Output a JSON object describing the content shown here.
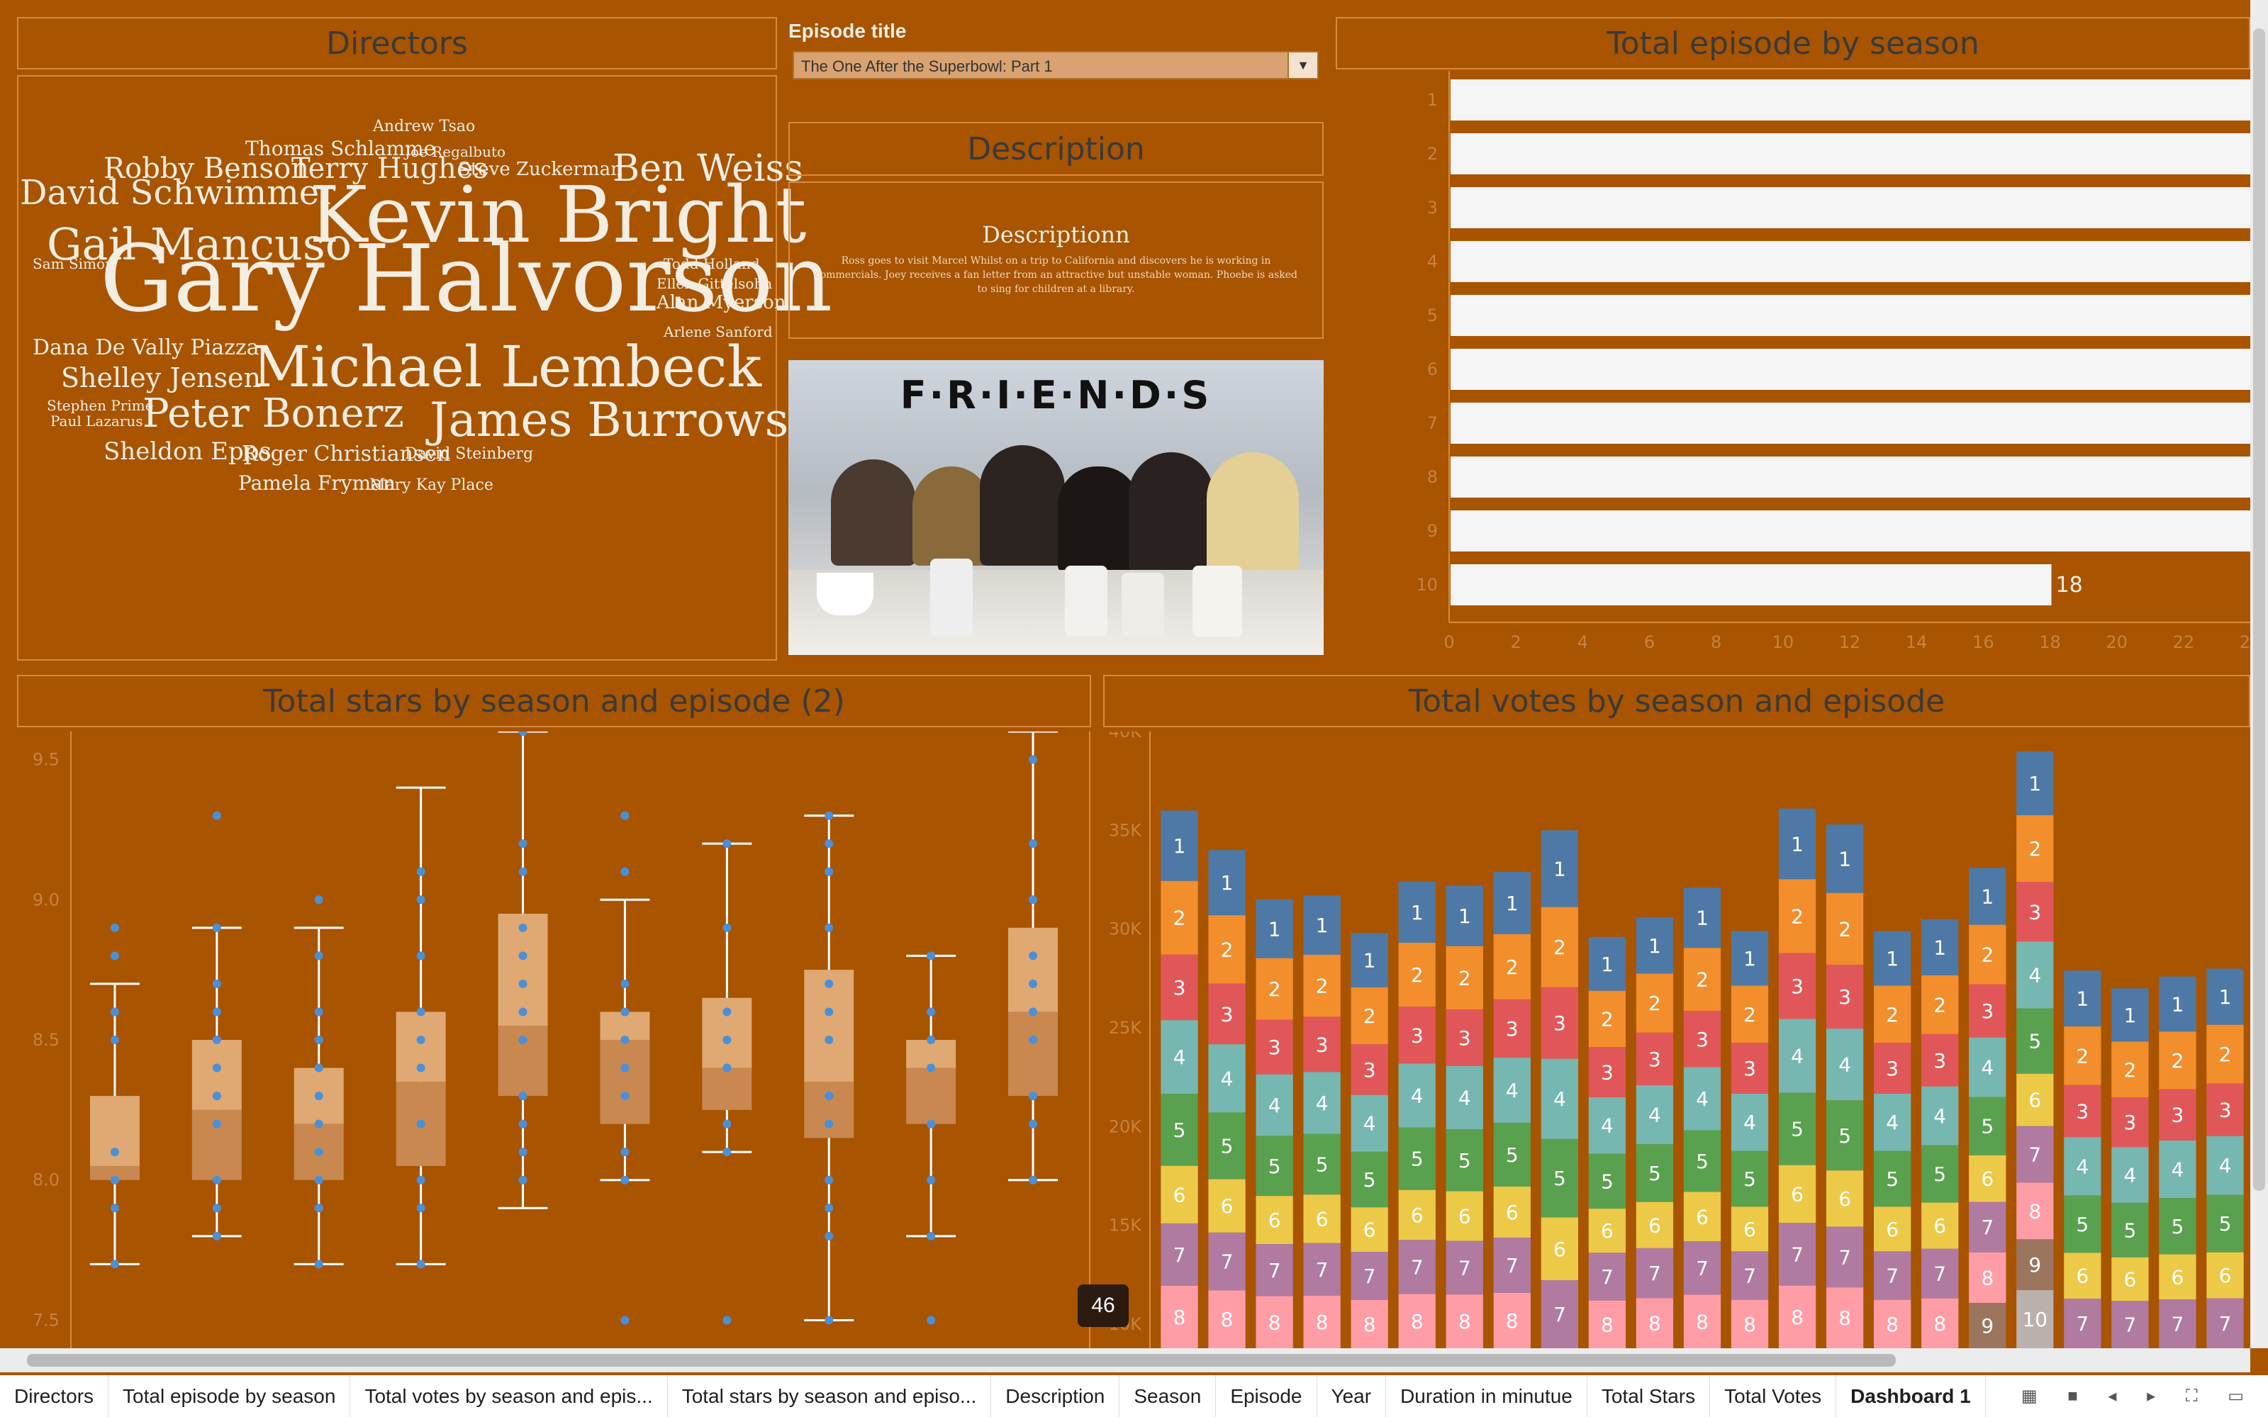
{
  "directors": {
    "title": "Directors",
    "words": [
      {
        "name": "Andrew Tsao",
        "size": 22
      },
      {
        "name": "Thomas Schlamme",
        "size": 28
      },
      {
        "name": "Joe Regalbuto",
        "size": 20
      },
      {
        "name": "Robby Benson",
        "size": 40
      },
      {
        "name": "Terry Hughes",
        "size": 40
      },
      {
        "name": "Steve Zuckerman",
        "size": 26
      },
      {
        "name": "Ben Weiss",
        "size": 52
      },
      {
        "name": "David Schwimmer",
        "size": 48
      },
      {
        "name": "Kevin Bright",
        "size": 110
      },
      {
        "name": "Gail Mancuso",
        "size": 62
      },
      {
        "name": "Sam Simon",
        "size": 20
      },
      {
        "name": "Gary Halvorson",
        "size": 130
      },
      {
        "name": "Todd Holland",
        "size": 20
      },
      {
        "name": "Ellen Gittelsohn",
        "size": 20
      },
      {
        "name": "Alan Myerson",
        "size": 26
      },
      {
        "name": "Arlene Sanford",
        "size": 20
      },
      {
        "name": "Dana De Vally Piazza",
        "size": 30
      },
      {
        "name": "Michael Lembeck",
        "size": 80
      },
      {
        "name": "Shelley Jensen",
        "size": 38
      },
      {
        "name": "Stephen Prime",
        "size": 20
      },
      {
        "name": "Peter Bonerz",
        "size": 56
      },
      {
        "name": "James Burrows",
        "size": 66
      },
      {
        "name": "Paul Lazarus",
        "size": 20
      },
      {
        "name": "Sheldon Epps",
        "size": 34
      },
      {
        "name": "Roger Christiansen",
        "size": 30
      },
      {
        "name": "David Steinberg",
        "size": 22
      },
      {
        "name": "Pamela Fryman",
        "size": 28
      },
      {
        "name": "Mary Kay Place",
        "size": 22
      }
    ]
  },
  "episode_filter": {
    "label": "Episode title",
    "value": "The One After the Superbowl: Part 1"
  },
  "description": {
    "title": "Description",
    "heading": "Descriptionn",
    "text": "Ross goes to visit Marcel Whilst on a trip to California and discovers he is working in commercials. Joey receives a fan letter from an attractive but unstable woman. Phoebe is asked to sing for children at a library."
  },
  "friends_image": {
    "logo": "F·R·I·E·N·D·S"
  },
  "colors": {
    "background": "#A85400",
    "bar": "#f5f5f5",
    "box": "#f0c08a",
    "point": "#4a90d9"
  },
  "tooltip_badge": "46",
  "tabs": [
    "Directors",
    "Total episode by season",
    "Total votes by season and epis...",
    "Total stars by season and episo...",
    "Description",
    "Season",
    "Episode",
    "Year",
    "Duration in minutue",
    "Total Stars",
    "Total Votes",
    "Dashboard 1"
  ],
  "chart_data": [
    {
      "type": "bar",
      "title": "Total episode by season",
      "categories": [
        "1",
        "2",
        "3",
        "4",
        "5",
        "6",
        "7",
        "8",
        "9",
        "10"
      ],
      "values": [
        24,
        24,
        25,
        24,
        24,
        25,
        24,
        24,
        24,
        18
      ],
      "data_labels": [
        "",
        "",
        "",
        "",
        "",
        "",
        "",
        "",
        "",
        "18"
      ],
      "xticks": [
        "0",
        "2",
        "4",
        "6",
        "8",
        "10",
        "12",
        "14",
        "16",
        "18",
        "20",
        "22",
        "24"
      ],
      "xlim": [
        0,
        24
      ],
      "orientation": "horizontal"
    },
    {
      "type": "box",
      "title": "Total stars by season and episode (2)",
      "categories": [
        "1",
        "2",
        "3",
        "4",
        "5",
        "6",
        "7",
        "8",
        "9",
        "10"
      ],
      "yticks": [
        "7.5",
        "8.0",
        "8.5",
        "9.0",
        "9.5"
      ],
      "ylim": [
        7.4,
        9.6
      ],
      "boxes": [
        {
          "min": 7.7,
          "q1": 8.0,
          "median": 8.05,
          "q3": 8.3,
          "max": 8.7,
          "points": [
            7.7,
            7.9,
            8.0,
            8.1,
            8.5,
            8.6,
            8.8,
            8.9
          ]
        },
        {
          "min": 7.8,
          "q1": 8.0,
          "median": 8.25,
          "q3": 8.5,
          "max": 8.9,
          "points": [
            7.8,
            7.9,
            8.0,
            8.2,
            8.3,
            8.4,
            8.5,
            8.6,
            8.7,
            8.9,
            9.3
          ]
        },
        {
          "min": 7.7,
          "q1": 8.0,
          "median": 8.2,
          "q3": 8.4,
          "max": 8.9,
          "points": [
            7.7,
            7.9,
            8.0,
            8.1,
            8.2,
            8.3,
            8.4,
            8.5,
            8.6,
            8.8,
            9.0
          ]
        },
        {
          "min": 7.7,
          "q1": 8.05,
          "median": 8.35,
          "q3": 8.6,
          "max": 9.4,
          "points": [
            7.7,
            7.9,
            8.0,
            8.2,
            8.4,
            8.5,
            8.6,
            8.8,
            9.0,
            9.1
          ]
        },
        {
          "min": 7.9,
          "q1": 8.3,
          "median": 8.55,
          "q3": 8.95,
          "max": 9.6,
          "points": [
            8.0,
            8.1,
            8.2,
            8.3,
            8.5,
            8.6,
            8.7,
            8.8,
            8.9,
            9.1,
            9.2,
            9.6
          ]
        },
        {
          "min": 8.0,
          "q1": 8.2,
          "median": 8.5,
          "q3": 8.6,
          "max": 9.0,
          "points": [
            7.5,
            8.0,
            8.1,
            8.3,
            8.4,
            8.5,
            8.6,
            8.7,
            9.1,
            9.3
          ]
        },
        {
          "min": 8.1,
          "q1": 8.25,
          "median": 8.4,
          "q3": 8.65,
          "max": 9.2,
          "points": [
            7.5,
            8.1,
            8.2,
            8.4,
            8.5,
            8.6,
            8.9,
            9.2
          ]
        },
        {
          "min": 7.5,
          "q1": 8.15,
          "median": 8.35,
          "q3": 8.75,
          "max": 9.3,
          "points": [
            7.5,
            7.8,
            7.9,
            8.0,
            8.2,
            8.3,
            8.5,
            8.6,
            8.7,
            8.9,
            9.1,
            9.2,
            9.3
          ]
        },
        {
          "min": 7.8,
          "q1": 8.2,
          "median": 8.4,
          "q3": 8.5,
          "max": 8.8,
          "points": [
            7.5,
            7.8,
            8.0,
            8.2,
            8.4,
            8.5,
            8.6,
            8.8
          ]
        },
        {
          "min": 8.0,
          "q1": 8.3,
          "median": 8.6,
          "q3": 8.9,
          "max": 9.6,
          "points": [
            8.0,
            8.2,
            8.3,
            8.5,
            8.6,
            8.7,
            8.8,
            9.0,
            9.2,
            9.5
          ]
        }
      ]
    },
    {
      "type": "bar",
      "stacked": true,
      "title": "Total votes by season and episode",
      "yticks": [
        "10K",
        "15K",
        "20K",
        "25K",
        "30K",
        "35K",
        "40K"
      ],
      "ylim": [
        0,
        42
      ],
      "segments": [
        "1",
        "2",
        "3",
        "4",
        "5",
        "6",
        "7",
        "8",
        "9",
        "10"
      ],
      "segment_colors": [
        "#4e79a7",
        "#f28e2b",
        "#e15759",
        "#76b7b2",
        "#59a14f",
        "#edc948",
        "#b07aa1",
        "#ff9da7",
        "#9c755f",
        "#bab0ac"
      ],
      "columns": [
        {
          "total": 36.0,
          "visible": [
            1,
            2,
            3,
            4,
            5,
            6,
            7,
            8
          ]
        },
        {
          "total": 34.0,
          "visible": [
            1,
            2,
            3,
            4,
            5,
            6,
            7,
            8
          ]
        },
        {
          "total": 31.5,
          "visible": [
            1,
            2,
            3,
            4,
            5,
            6,
            7,
            8
          ]
        },
        {
          "total": 31.7,
          "visible": [
            1,
            2,
            3,
            4,
            5,
            6,
            7,
            8
          ]
        },
        {
          "total": 29.8,
          "visible": [
            1,
            2,
            3,
            4,
            5,
            6,
            7,
            8
          ]
        },
        {
          "total": 32.4,
          "visible": [
            1,
            2,
            3,
            4,
            5,
            6,
            7,
            8
          ]
        },
        {
          "total": 32.2,
          "visible": [
            1,
            2,
            3,
            4,
            5,
            6,
            7,
            8
          ]
        },
        {
          "total": 32.9,
          "visible": [
            1,
            2,
            3,
            4,
            5,
            6,
            7,
            8
          ]
        },
        {
          "total": 35.0,
          "visible": [
            1,
            2,
            3,
            4,
            5,
            6,
            7
          ]
        },
        {
          "total": 29.6,
          "visible": [
            1,
            2,
            3,
            4,
            5,
            6,
            7,
            8
          ]
        },
        {
          "total": 30.6,
          "visible": [
            1,
            2,
            3,
            4,
            5,
            6,
            7,
            8
          ]
        },
        {
          "total": 32.1,
          "visible": [
            1,
            2,
            3,
            4,
            5,
            6,
            7,
            8
          ]
        },
        {
          "total": 29.9,
          "visible": [
            1,
            2,
            3,
            4,
            5,
            6,
            7,
            8
          ]
        },
        {
          "total": 36.1,
          "visible": [
            1,
            2,
            3,
            4,
            5,
            6,
            7,
            8
          ]
        },
        {
          "total": 35.3,
          "visible": [
            1,
            2,
            3,
            4,
            5,
            6,
            7,
            8
          ]
        },
        {
          "total": 29.9,
          "visible": [
            1,
            2,
            3,
            4,
            5,
            6,
            7,
            8
          ]
        },
        {
          "total": 30.5,
          "visible": [
            1,
            2,
            3,
            4,
            5,
            6,
            7,
            8
          ]
        },
        {
          "total": 33.1,
          "visible": [
            1,
            2,
            3,
            4,
            5,
            6,
            7,
            8,
            9
          ]
        },
        {
          "total": 39.0,
          "visible": [
            1,
            2,
            3,
            4,
            5,
            6,
            7,
            8,
            9,
            10
          ]
        },
        {
          "total": 27.9,
          "visible": [
            1,
            2,
            3,
            4,
            5,
            6,
            7
          ]
        },
        {
          "total": 27.0,
          "visible": [
            1,
            2,
            3,
            4,
            5,
            6,
            7
          ]
        },
        {
          "total": 27.6,
          "visible": [
            1,
            2,
            3,
            4,
            5,
            6,
            7
          ]
        },
        {
          "total": 28.0,
          "visible": [
            1,
            2,
            3,
            4,
            5,
            6,
            7
          ]
        }
      ]
    }
  ]
}
